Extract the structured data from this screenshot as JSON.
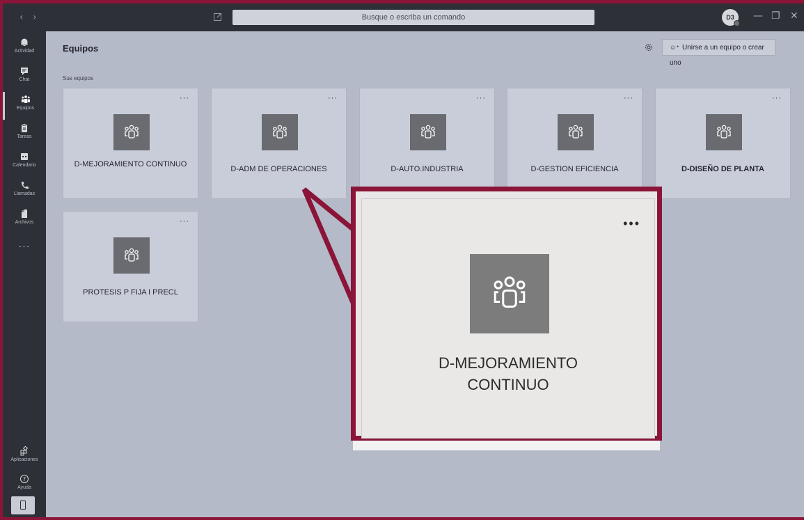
{
  "titlebar": {
    "back_glyph": "‹",
    "forward_glyph": "›",
    "search_placeholder": "Busque o escriba un comando",
    "avatar_initials": "D3",
    "minimize_glyph": "—",
    "restore_glyph": "❐",
    "close_glyph": "✕"
  },
  "rail": {
    "items": [
      {
        "label": "Actividad",
        "icon": "bell-icon"
      },
      {
        "label": "Chat",
        "icon": "chat-icon"
      },
      {
        "label": "Equipos",
        "icon": "teams-icon",
        "active": true
      },
      {
        "label": "Tareas",
        "icon": "tasks-icon"
      },
      {
        "label": "Calendario",
        "icon": "calendar-icon"
      },
      {
        "label": "Llamadas",
        "icon": "phone-icon"
      },
      {
        "label": "Archivos",
        "icon": "files-icon"
      }
    ],
    "more": "···",
    "apps_label": "Aplicaciones",
    "help_label": "Ayuda"
  },
  "main": {
    "title": "Equipos",
    "join_label": "Unirse a un equipo o crear uno",
    "section_label": "Sus equipos",
    "card_more": "···",
    "teams": [
      {
        "name": "D-MEJORAMIENTO CONTINUO",
        "bold": false
      },
      {
        "name": "D-ADM DE OPERACIONES",
        "bold": false
      },
      {
        "name": "D-AUTO.INDUSTRIA",
        "bold": false
      },
      {
        "name": "D-GESTION EFICIENCIA",
        "bold": false
      },
      {
        "name": "D-DISEÑO DE PLANTA",
        "bold": true
      },
      {
        "name": "PROTESIS P FIJA I PRECL",
        "bold": false
      }
    ]
  },
  "zoom": {
    "more": "•••",
    "name_line1": "D-MEJORAMIENTO",
    "name_line2": "CONTINUO"
  },
  "colors": {
    "frame": "#8a1538",
    "rail": "#2e3037",
    "main_bg": "#b5bac8",
    "card_bg": "#c9cdd9",
    "tile": "#6a6b70"
  }
}
